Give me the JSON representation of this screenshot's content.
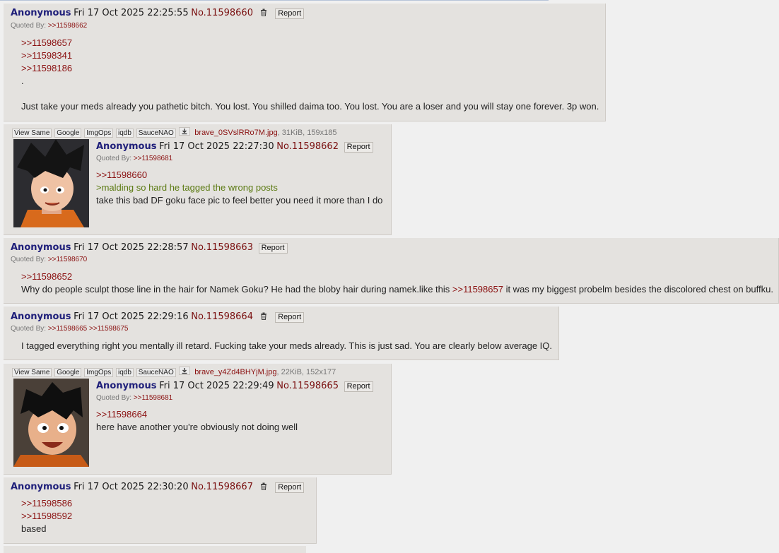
{
  "posts": [
    {
      "name": "Anonymous",
      "date": "Fri 17 Oct 2025 22:25:55",
      "number": "No.11598660",
      "report": "Report",
      "quoted_label": "Quoted By:",
      "quoted_by": [
        ">>11598662"
      ],
      "quotes": [
        ">>11598657",
        ">>11598341",
        ">>11598186"
      ],
      "dot": ".",
      "text": "Just take your meds already you pathetic bitch. You lost. You shilled daima too. You lost. You are a loser and you will stay one forever. 3p won."
    },
    {
      "file_buttons": [
        "View Same",
        "Google",
        "ImgOps",
        "iqdb",
        "SauceNAO"
      ],
      "filename": "brave_0SVslRRo7M.jpg",
      "filemeta": ", 31KiB, 159x185",
      "name": "Anonymous",
      "date": "Fri 17 Oct 2025 22:27:30",
      "number": "No.11598662",
      "report": "Report",
      "quoted_label": "Quoted By:",
      "quoted_by": [
        ">>11598681"
      ],
      "quote": ">>11598660",
      "greentext": ">malding so hard he tagged the wrong posts",
      "text": "take this bad DF goku face pic to feel better you need it more than I do"
    },
    {
      "name": "Anonymous",
      "date": "Fri 17 Oct 2025 22:28:57",
      "number": "No.11598663",
      "report": "Report",
      "quoted_label": "Quoted By:",
      "quoted_by": [
        ">>11598670"
      ],
      "quote": ">>11598652",
      "text_before": "Why do people sculpt those line in the hair for Namek Goku? He had the bloby hair during namek.like this ",
      "inline_quote": ">>11598657",
      "text_after": " it was my biggest probelm besides the discolored chest on buffku."
    },
    {
      "name": "Anonymous",
      "date": "Fri 17 Oct 2025 22:29:16",
      "number": "No.11598664",
      "report": "Report",
      "quoted_label": "Quoted By:",
      "quoted_by": [
        ">>11598665",
        ">>11598675"
      ],
      "text": "I tagged everything right you mentally ill retard. Fucking take your meds already. This is just sad. You are clearly below average IQ."
    },
    {
      "file_buttons": [
        "View Same",
        "Google",
        "ImgOps",
        "iqdb",
        "SauceNAO"
      ],
      "filename": "brave_y4Zd4BHYjM.jpg",
      "filemeta": ", 22KiB, 152x177",
      "name": "Anonymous",
      "date": "Fri 17 Oct 2025 22:29:49",
      "number": "No.11598665",
      "report": "Report",
      "quoted_label": "Quoted By:",
      "quoted_by": [
        ">>11598681"
      ],
      "quote": ">>11598664",
      "text": "here have another you're obviously not doing well"
    },
    {
      "name": "Anonymous",
      "date": "Fri 17 Oct 2025 22:30:20",
      "number": "No.11598667",
      "report": "Report",
      "quotes": [
        ">>11598586",
        ">>11598592"
      ],
      "text": "based"
    }
  ],
  "colors": {
    "post_bg": "#e4e2df",
    "name": "#1f1f7a",
    "quote": "#8a1010",
    "greentext": "#5b7a12"
  },
  "icons": {
    "delete": "trash-icon",
    "download": "download-icon"
  }
}
